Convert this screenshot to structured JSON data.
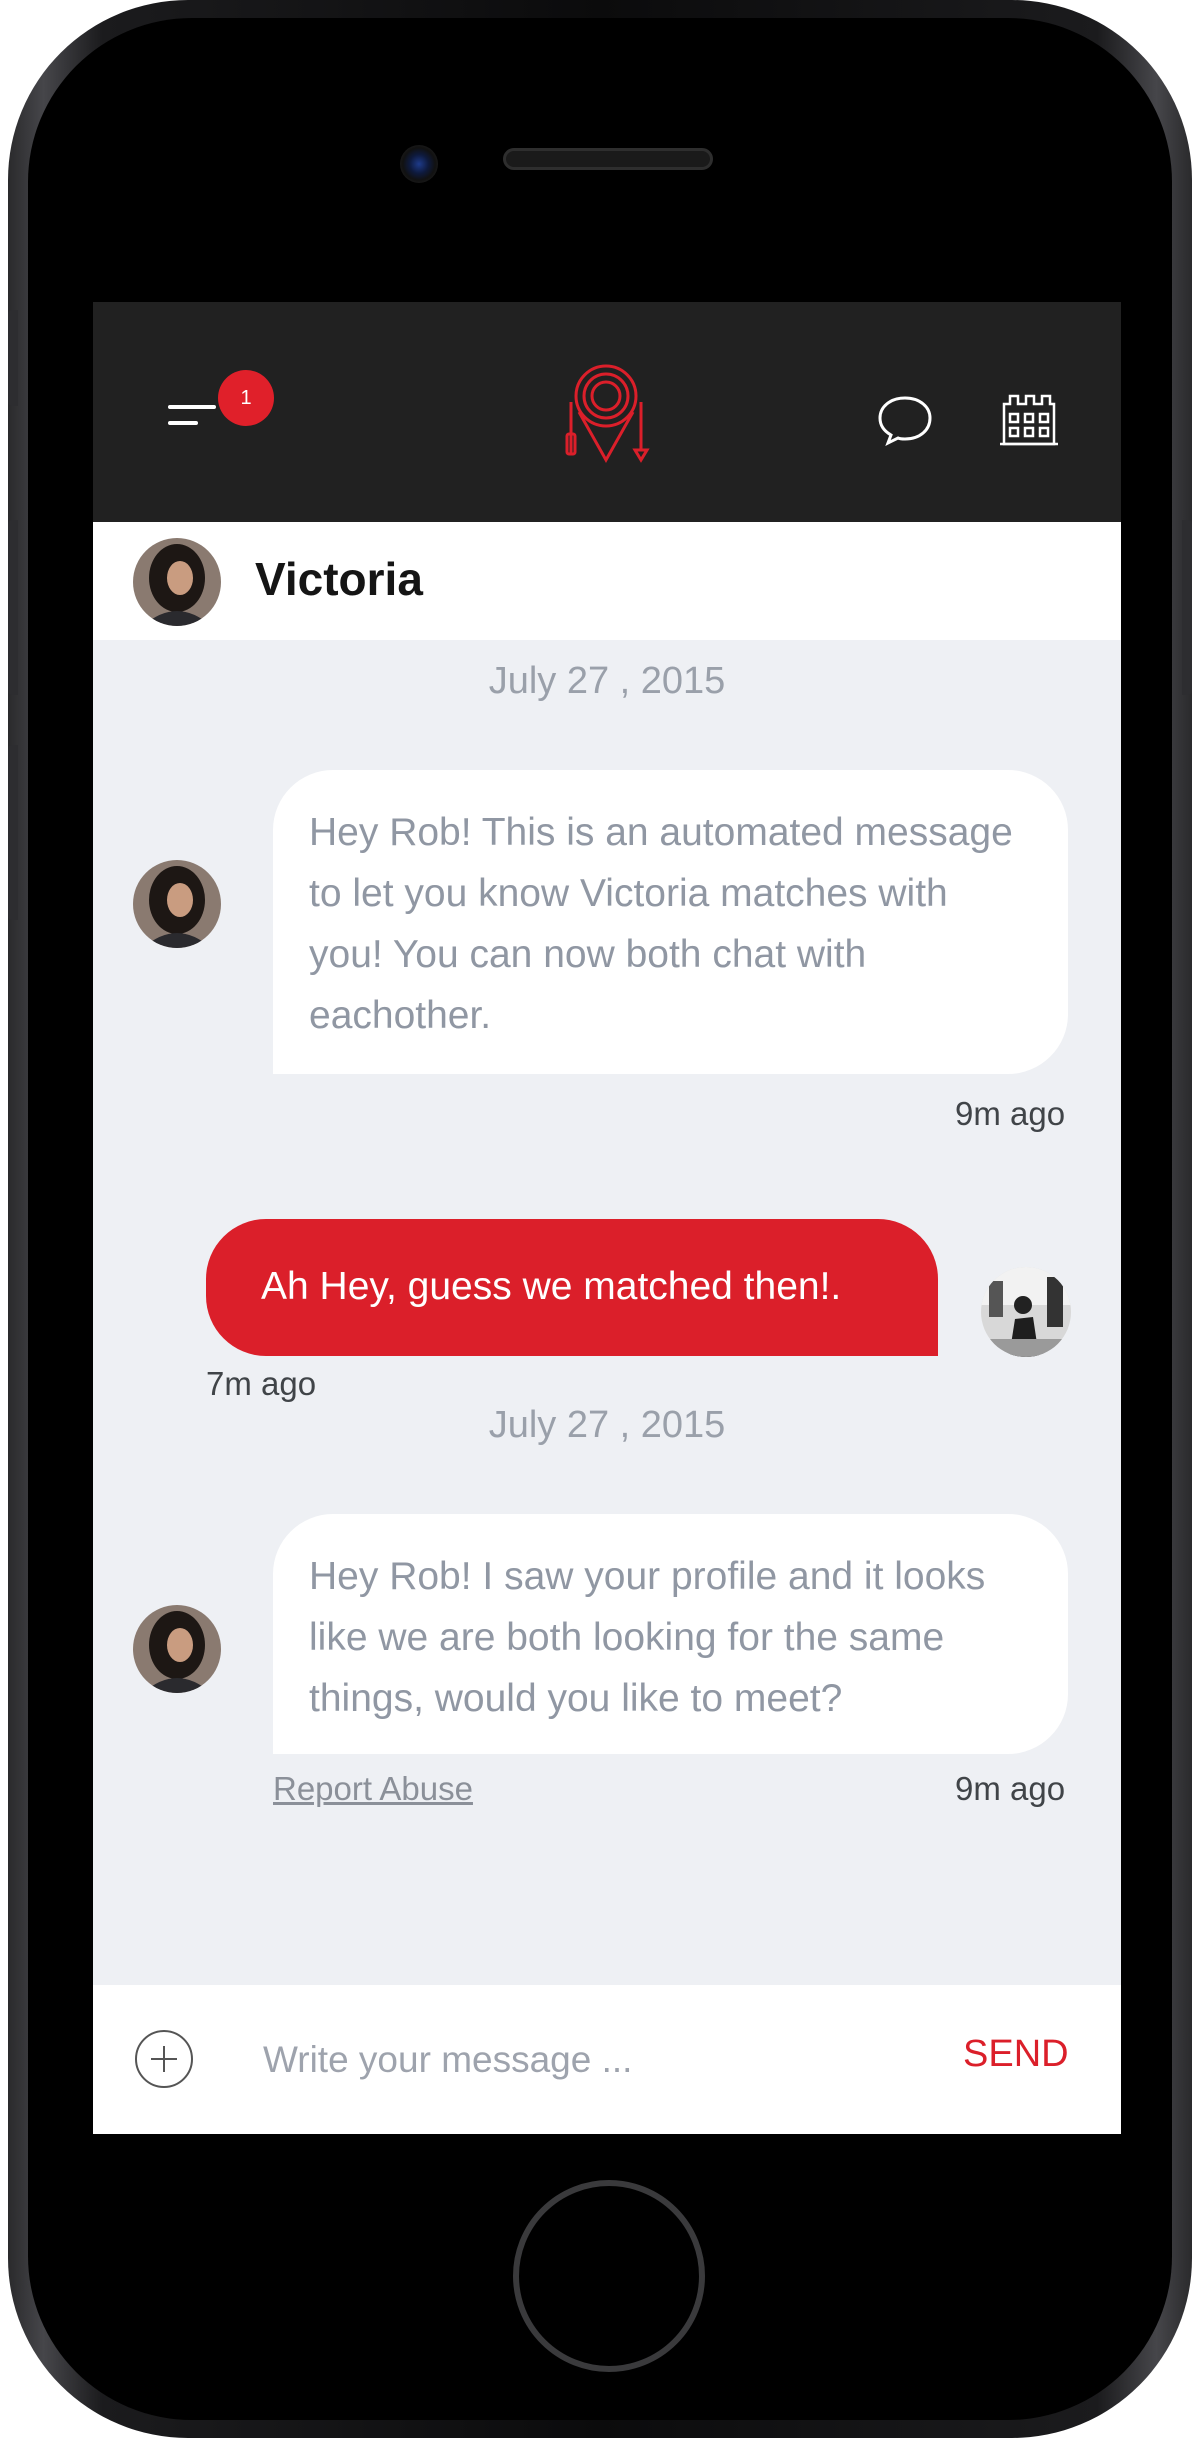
{
  "topbar": {
    "notification_count": "1",
    "brand_color": "#db1f2a",
    "icons": [
      "menu-icon",
      "app-logo-icon",
      "chat-icon",
      "building-icon"
    ]
  },
  "header": {
    "contact_name": "Victoria"
  },
  "conversation": {
    "date_1": "July 27 , 2015",
    "msg_1": {
      "text": "Hey Rob! This is an automated message to let you know Victoria matches with you! You can now both chat with eachother.",
      "time": "9m ago"
    },
    "msg_2": {
      "text": "Ah Hey, guess we matched then!.",
      "time": "7m ago"
    },
    "date_2": "July 27 , 2015",
    "msg_3": {
      "text": "Hey Rob! I saw your profile and it looks like we are both looking for the same things, would you like to meet?",
      "time": "9m ago"
    },
    "report_label": "Report Abuse"
  },
  "composer": {
    "placeholder": "Write your message ...",
    "send_label": "SEND"
  }
}
